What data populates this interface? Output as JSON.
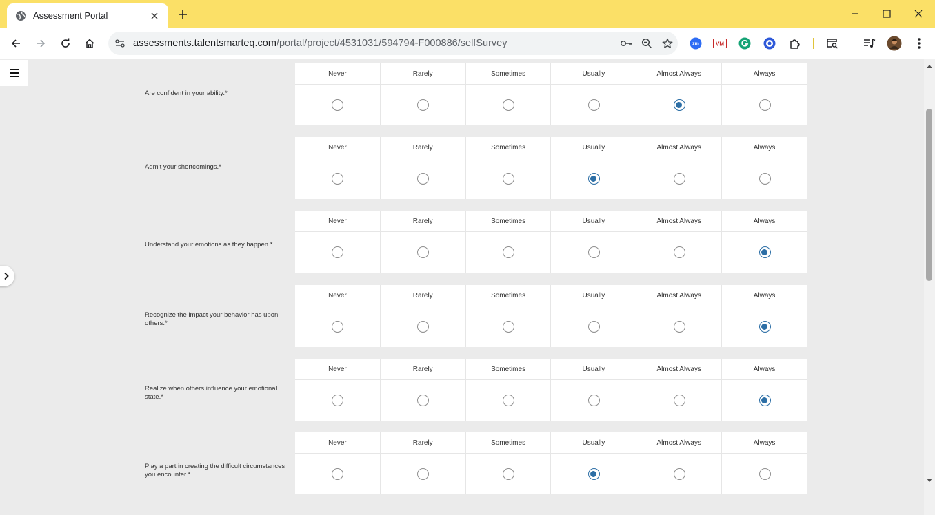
{
  "browser": {
    "tab_title": "Assessment Portal",
    "url_host": "assessments.talentsmarteq.com",
    "url_path": "/portal/project/4531031/594794-F000886/selfSurvey"
  },
  "survey": {
    "options": [
      "Never",
      "Rarely",
      "Sometimes",
      "Usually",
      "Almost Always",
      "Always"
    ],
    "questions": [
      {
        "text": "Are confident in your ability.*",
        "selected": "Almost Always"
      },
      {
        "text": "Admit your shortcomings.*",
        "selected": "Usually"
      },
      {
        "text": "Understand your emotions as they happen.*",
        "selected": "Always"
      },
      {
        "text": "Recognize the impact your behavior has upon others.*",
        "selected": "Always"
      },
      {
        "text": "Realize when others influence your emotional state.*",
        "selected": "Always"
      },
      {
        "text": "Play a part in creating the difficult circumstances you encounter.*",
        "selected": "Usually"
      }
    ]
  },
  "colors": {
    "titlebar": "#fbe067",
    "radio_selected": "#2d6fa6",
    "page_bg": "#ebebeb"
  },
  "icons": {
    "tab": "globe-icon",
    "menu": "hamburger-menu-icon",
    "sidebar_toggle": "chevron-right-icon"
  }
}
